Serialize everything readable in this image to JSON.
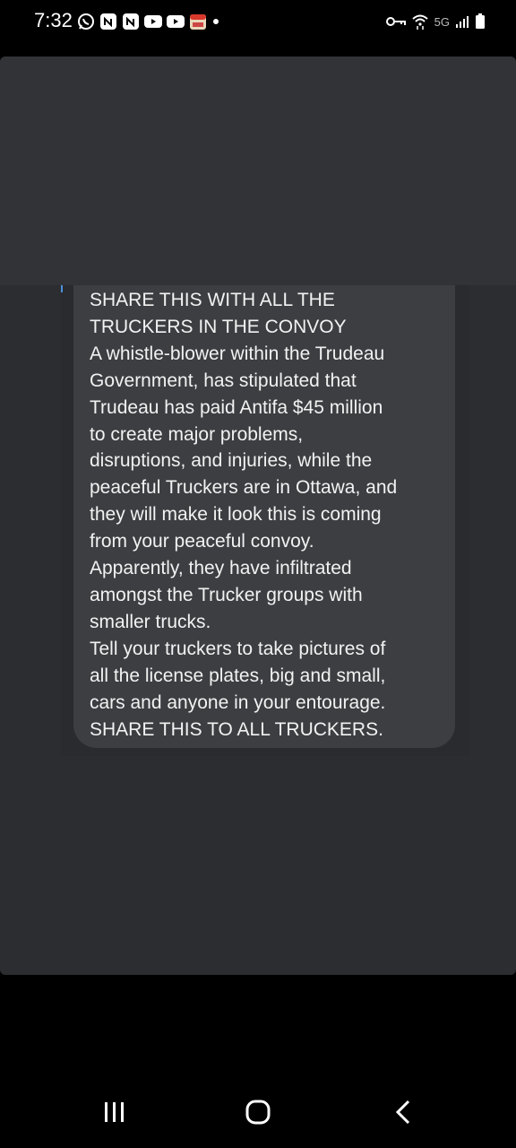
{
  "status_bar": {
    "time": "7:32",
    "network": "5G",
    "left_icons": [
      "whatsapp-icon",
      "notification-n-icon",
      "notification-n-icon",
      "youtube-icon",
      "youtube-icon",
      "app-icon",
      "dot-icon"
    ],
    "right_icons": [
      "key-icon",
      "wifi-icon",
      "signal-icon",
      "battery-icon"
    ]
  },
  "message": {
    "lines": [
      "SHARE THIS WITH ALL THE",
      "TRUCKERS IN THE CONVOY",
      "A whistle-blower within the Trudeau",
      "Government, has stipulated that",
      "Trudeau has paid Antifa $45 million",
      "to create major problems,",
      "disruptions, and injuries, while the",
      "peaceful Truckers are in Ottawa, and",
      "they will make it look this is coming",
      "from your peaceful convoy.",
      "Apparently, they have infiltrated",
      "amongst the Trucker groups with",
      "smaller trucks.",
      "Tell your truckers to take pictures of",
      "all the license plates, big and small,",
      "cars and anyone in your entourage.",
      "SHARE THIS TO ALL TRUCKERS."
    ]
  },
  "nav_bar": {
    "buttons": [
      "recent-apps",
      "home",
      "back"
    ]
  },
  "colors": {
    "panel": "#2c2d30",
    "bubble": "#3d3e42",
    "text": "#f2f2f2"
  }
}
